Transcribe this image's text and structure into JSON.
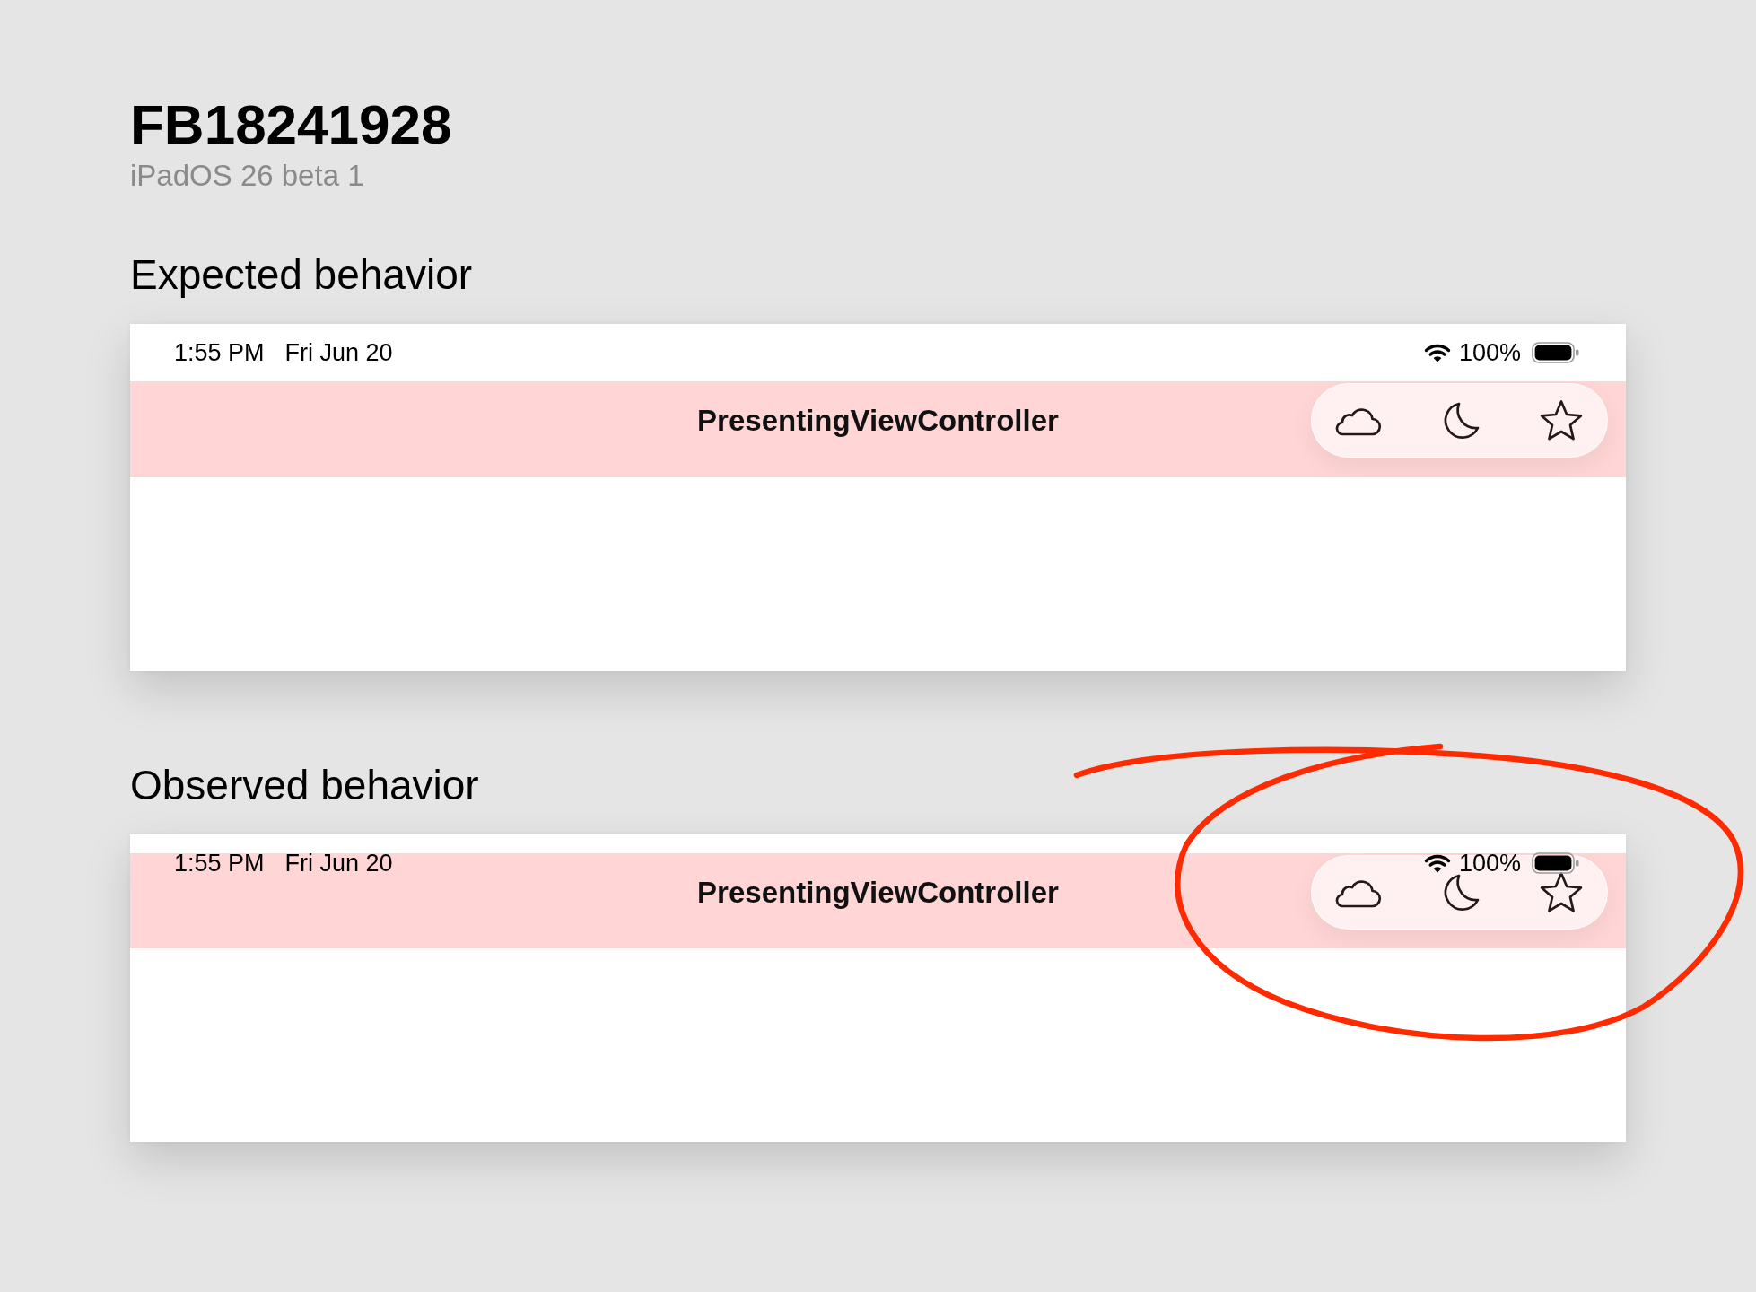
{
  "report": {
    "title": "FB18241928",
    "subtitle": "iPadOS 26 beta 1"
  },
  "sections": [
    {
      "heading": "Expected behavior",
      "circled": false,
      "screen": {
        "status_bar_overlapped": false,
        "status_bar": {
          "time": "1:55 PM",
          "date": "Fri Jun 20",
          "battery": "100%"
        },
        "nav_bar": {
          "title": "PresentingViewController",
          "buttons": [
            {
              "kind": "cloud"
            },
            {
              "kind": "moon"
            },
            {
              "kind": "star"
            }
          ]
        }
      }
    },
    {
      "heading": "Observed behavior",
      "circled": true,
      "screen": {
        "status_bar_overlapped": true,
        "status_bar": {
          "time": "1:55 PM",
          "date": "Fri Jun 20",
          "battery": "100%"
        },
        "nav_bar": {
          "title": "PresentingViewController",
          "buttons": [
            {
              "kind": "cloud"
            },
            {
              "kind": "moon"
            },
            {
              "kind": "star"
            }
          ]
        }
      }
    }
  ]
}
